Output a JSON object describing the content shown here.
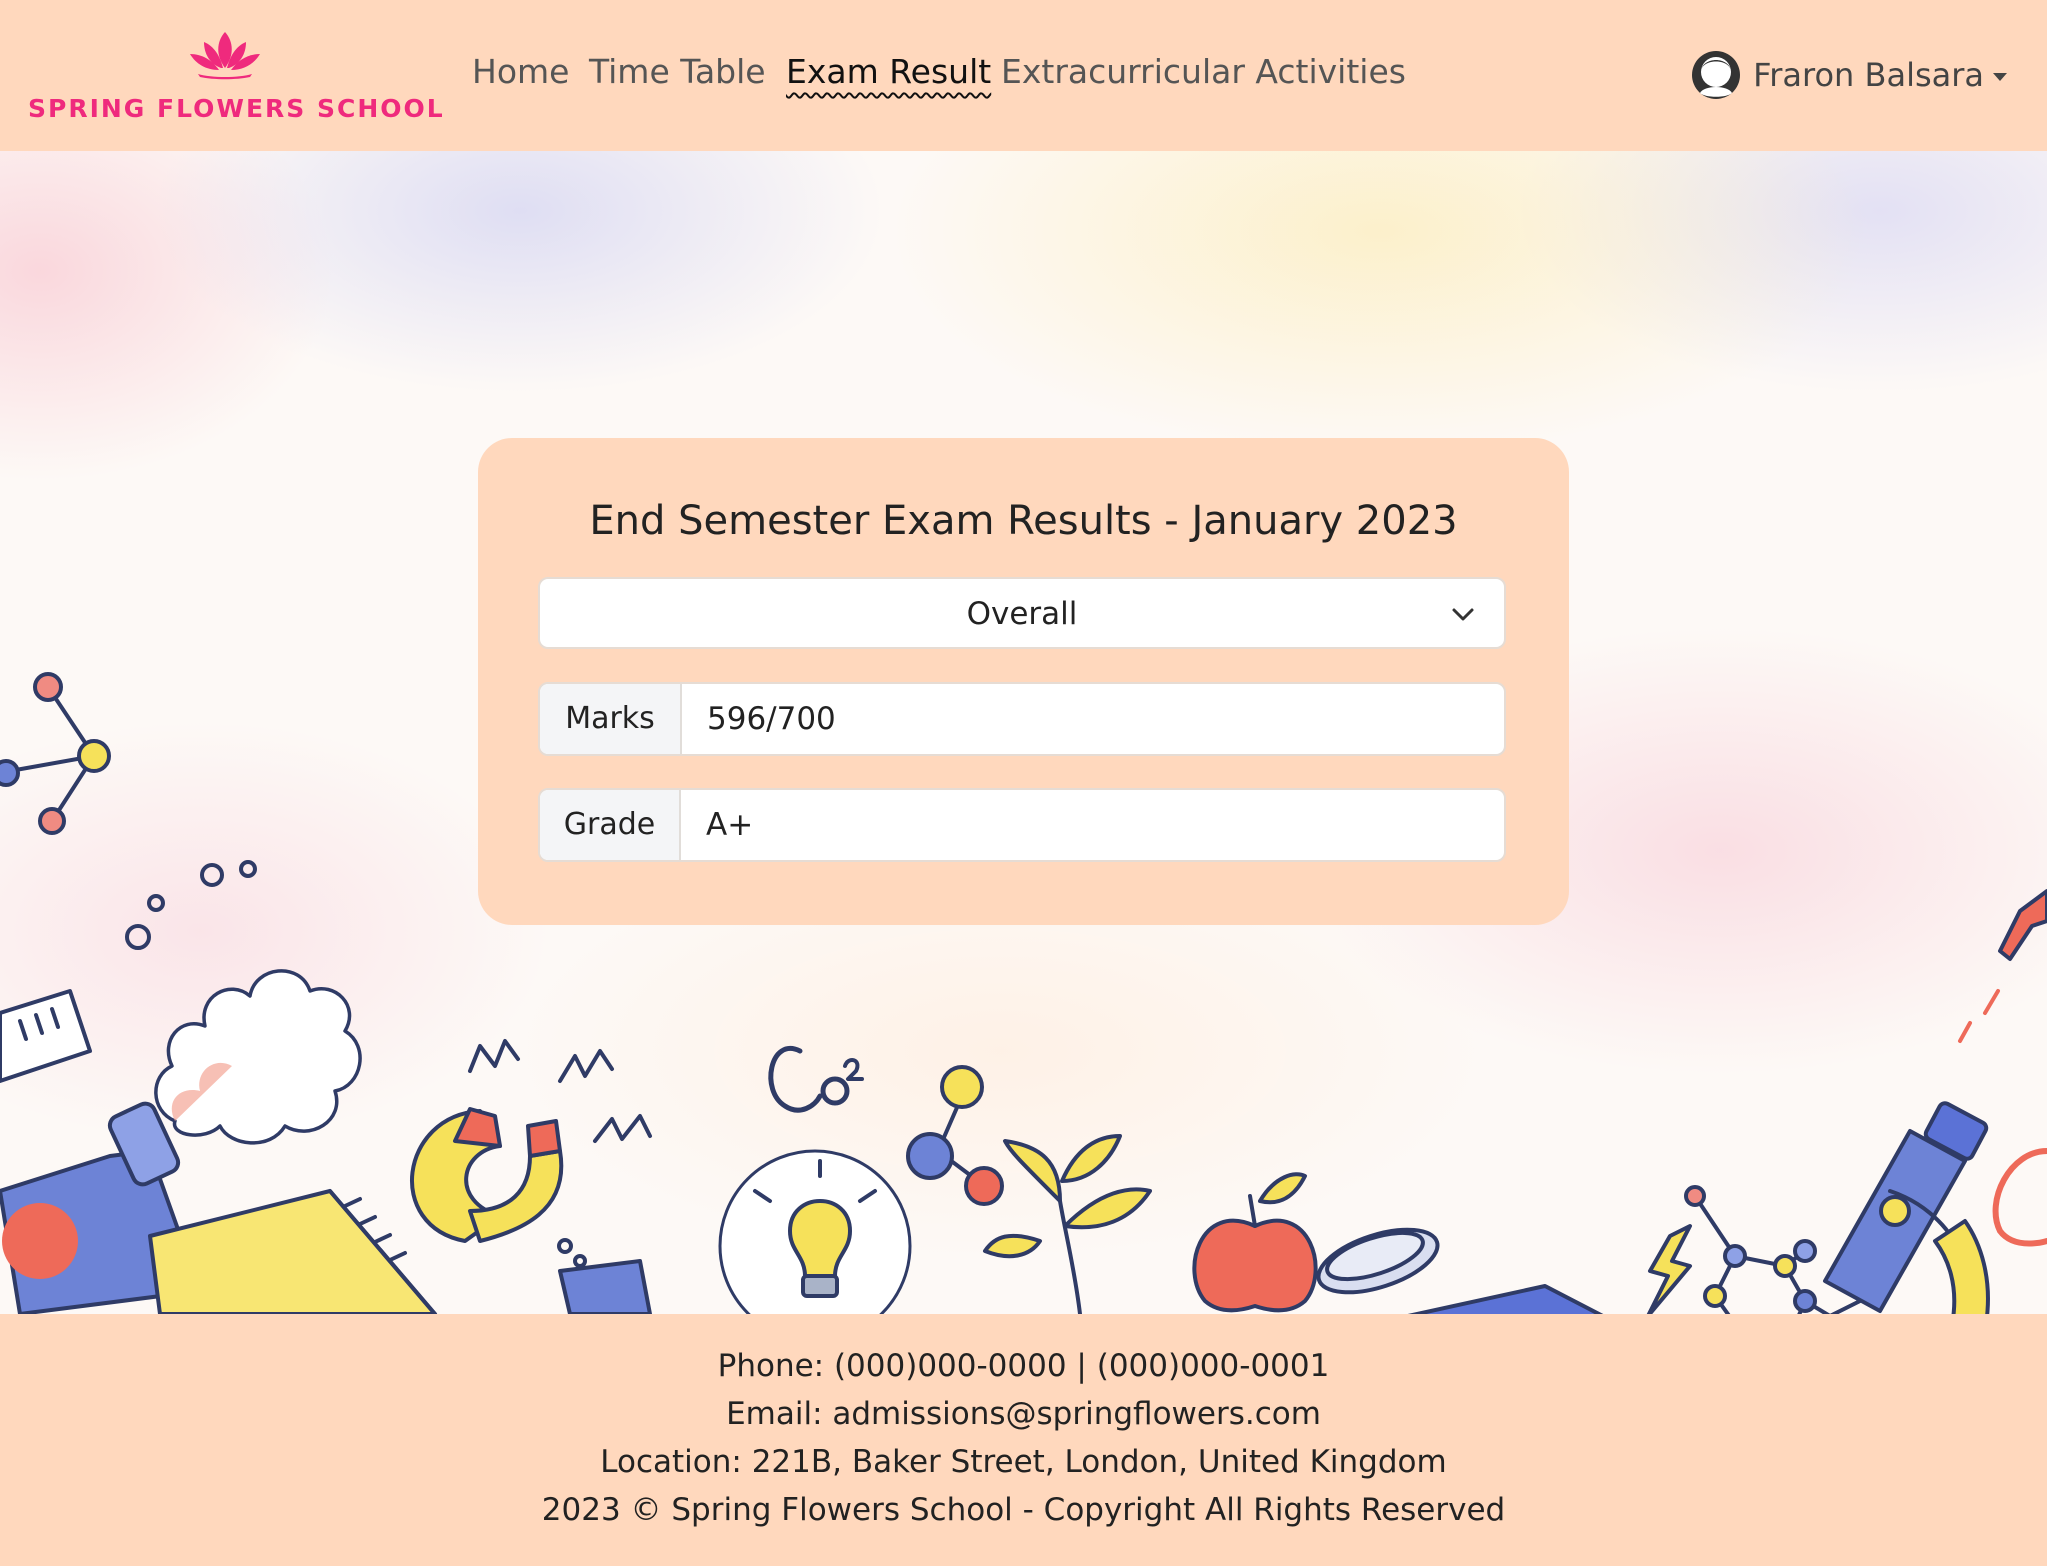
{
  "brand": {
    "name": "SPRING FLOWERS SCHOOL",
    "logo_icon": "lotus-icon",
    "logo_color": "#ef2a7d"
  },
  "nav": {
    "items": [
      {
        "label": "Home",
        "active": false
      },
      {
        "label": "Time Table",
        "active": false
      },
      {
        "label": "Exam Result",
        "active": true
      },
      {
        "label": "Extracurricular Activities",
        "active": false
      }
    ]
  },
  "user": {
    "name": "Fraron Balsara",
    "avatar_icon": "user-avatar-icon",
    "dropdown_icon": "caret-down-icon"
  },
  "result": {
    "title": "End Semester Exam Results - January 2023",
    "selected_option": "Overall",
    "marks_label": "Marks",
    "marks_value": "596/700",
    "grade_label": "Grade",
    "grade_value": "A+"
  },
  "footer": {
    "phone": "Phone: (000)000-0000 | (000)000-0001",
    "email": "Email: admissions@springflowers.com",
    "location": "Location: 221B, Baker Street, London, United Kingdom",
    "copyright": "2023 © Spring Flowers School - Copyright All Rights Reserved"
  },
  "colors": {
    "header_bg": "#ffd8bd",
    "card_bg": "#ffd8bd",
    "footer_bg": "#ffd8bd",
    "accent": "#ef2a7d"
  }
}
